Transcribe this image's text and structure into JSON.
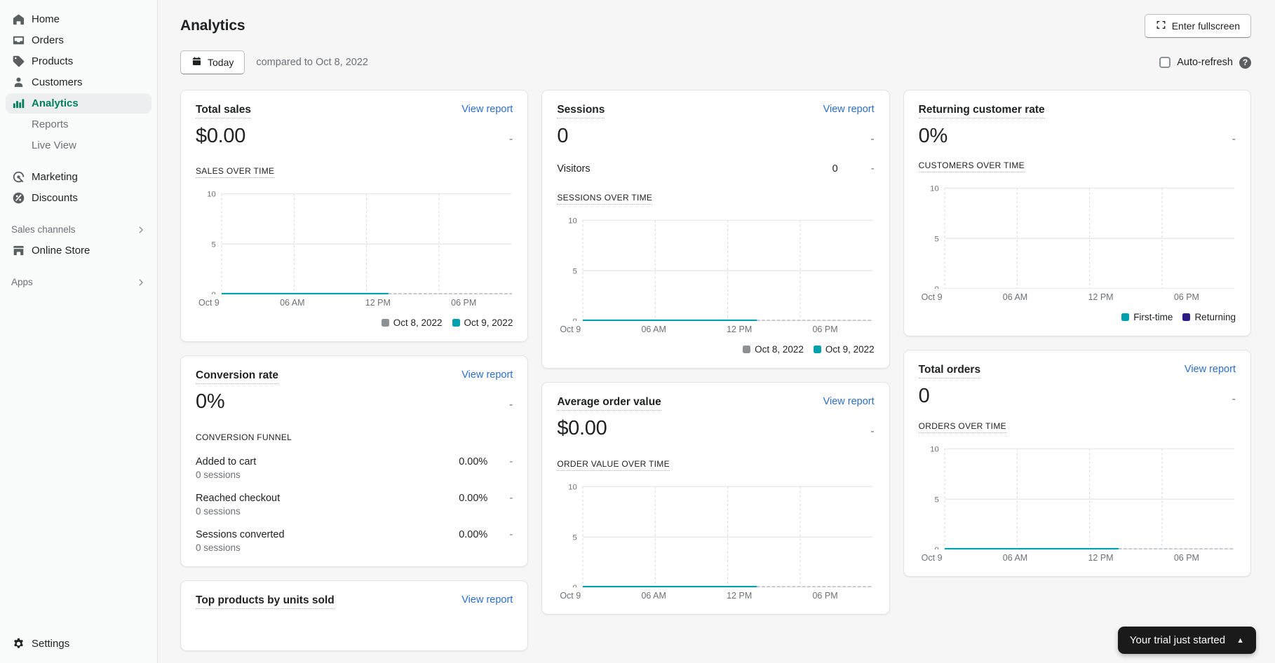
{
  "sidebar": {
    "items": [
      {
        "label": "Home",
        "icon": "home-icon",
        "active": false
      },
      {
        "label": "Orders",
        "icon": "orders-icon",
        "active": false
      },
      {
        "label": "Products",
        "icon": "products-tag-icon",
        "active": false
      },
      {
        "label": "Customers",
        "icon": "customers-person-icon",
        "active": false
      },
      {
        "label": "Analytics",
        "icon": "analytics-bars-icon",
        "active": true
      }
    ],
    "sub_items": [
      {
        "label": "Reports"
      },
      {
        "label": "Live View"
      }
    ],
    "items2": [
      {
        "label": "Marketing",
        "icon": "marketing-icon"
      },
      {
        "label": "Discounts",
        "icon": "discounts-icon"
      }
    ],
    "sales_channels": {
      "label": "Sales channels"
    },
    "online_store": {
      "label": "Online Store",
      "icon": "store-icon"
    },
    "apps": {
      "label": "Apps"
    },
    "settings": {
      "label": "Settings",
      "icon": "gear-icon"
    }
  },
  "header": {
    "title": "Analytics",
    "fullscreen_label": "Enter fullscreen"
  },
  "filters": {
    "date_label": "Today",
    "compared_to": "compared to Oct 8, 2022",
    "auto_refresh_label": "Auto-refresh",
    "help_glyph": "?"
  },
  "colors": {
    "teal": "#00a0ac",
    "grey": "#8c9196",
    "navy": "#2e1a87",
    "link": "#2c6ecb",
    "accent_green": "#007f5f"
  },
  "cards": {
    "total_sales": {
      "title": "Total sales",
      "view_report": "View report",
      "value": "$0.00",
      "delta": "-",
      "chart_caption": "SALES OVER TIME"
    },
    "conversion_rate": {
      "title": "Conversion rate",
      "view_report": "View report",
      "value": "0%",
      "delta": "-",
      "funnel_caption": "CONVERSION FUNNEL",
      "rows": [
        {
          "label": "Added to cart",
          "sub": "0 sessions",
          "pct": "0.00%",
          "delta": "-"
        },
        {
          "label": "Reached checkout",
          "sub": "0 sessions",
          "pct": "0.00%",
          "delta": "-"
        },
        {
          "label": "Sessions converted",
          "sub": "0 sessions",
          "pct": "0.00%",
          "delta": "-"
        }
      ]
    },
    "top_products": {
      "title": "Top products by units sold",
      "view_report": "View report"
    },
    "sessions": {
      "title": "Sessions",
      "view_report": "View report",
      "value": "0",
      "delta": "-",
      "visitors_label": "Visitors",
      "visitors_value": "0",
      "visitors_delta": "-",
      "chart_caption": "SESSIONS OVER TIME"
    },
    "average_order_value": {
      "title": "Average order value",
      "view_report": "View report",
      "value": "$0.00",
      "delta": "-",
      "chart_caption": "ORDER VALUE OVER TIME"
    },
    "returning_customer_rate": {
      "title": "Returning customer rate",
      "value": "0%",
      "delta": "-",
      "chart_caption": "CUSTOMERS OVER TIME"
    },
    "total_orders": {
      "title": "Total orders",
      "view_report": "View report",
      "value": "0",
      "delta": "-",
      "chart_caption": "ORDERS OVER TIME"
    }
  },
  "toast": {
    "message": "Your trial just started",
    "caret": "▲"
  },
  "chart_data": [
    {
      "id": "sales_over_time",
      "type": "line",
      "title": "SALES OVER TIME",
      "xlabel": "",
      "ylabel": "",
      "ylim": [
        0,
        10
      ],
      "yticks": [
        0,
        5,
        10
      ],
      "ytick_labels": [
        "0",
        "5",
        "10"
      ],
      "xtick_labels": [
        "Oct 9",
        "06 AM",
        "12 PM",
        "06 PM"
      ],
      "grid": true,
      "legend": [
        {
          "name": "Oct 8, 2022",
          "color": "#8c9196"
        },
        {
          "name": "Oct 9, 2022",
          "color": "#00a0ac"
        }
      ],
      "series": [
        {
          "name": "Oct 9, 2022",
          "color": "#00a0ac",
          "style": "solid",
          "x_frac_end": 0.575,
          "values": [
            0,
            0,
            0,
            0,
            0,
            0,
            0,
            0,
            0,
            0,
            0,
            0,
            0,
            0
          ]
        },
        {
          "name": "Oct 8, 2022",
          "color": "#c4c8cc",
          "style": "dotted",
          "x_frac_start": 0.575,
          "values": [
            0,
            0,
            0,
            0,
            0,
            0,
            0,
            0,
            0,
            0
          ]
        }
      ]
    },
    {
      "id": "sessions_over_time",
      "type": "line",
      "title": "SESSIONS OVER TIME",
      "ylim": [
        0,
        10
      ],
      "yticks": [
        0,
        5,
        10
      ],
      "ytick_labels": [
        "0",
        "5",
        "10"
      ],
      "xtick_labels": [
        "Oct 9",
        "06 AM",
        "12 PM",
        "06 PM"
      ],
      "grid": true,
      "legend": [
        {
          "name": "Oct 8, 2022",
          "color": "#8c9196"
        },
        {
          "name": "Oct 9, 2022",
          "color": "#00a0ac"
        }
      ],
      "series": [
        {
          "name": "Oct 9, 2022",
          "color": "#00a0ac",
          "style": "solid",
          "x_frac_end": 0.6,
          "values": [
            0,
            0,
            0,
            0,
            0,
            0,
            0,
            0,
            0,
            0
          ]
        },
        {
          "name": "Oct 8, 2022",
          "color": "#c4c8cc",
          "style": "dotted",
          "x_frac_start": 0.6,
          "values": [
            0,
            0,
            0,
            0,
            0,
            0,
            0
          ]
        }
      ]
    },
    {
      "id": "customers_over_time",
      "type": "line",
      "title": "CUSTOMERS OVER TIME",
      "ylim": [
        0,
        10
      ],
      "yticks": [
        0,
        5,
        10
      ],
      "ytick_labels": [
        "0",
        "5",
        "10"
      ],
      "xtick_labels": [
        "Oct 9",
        "06 AM",
        "12 PM",
        "06 PM"
      ],
      "grid": true,
      "legend": [
        {
          "name": "First-time",
          "color": "#00a0ac"
        },
        {
          "name": "Returning",
          "color": "#2e1a87"
        }
      ],
      "series": []
    },
    {
      "id": "order_value_over_time",
      "type": "line",
      "title": "ORDER VALUE OVER TIME",
      "ylim": [
        0,
        10
      ],
      "yticks": [
        0,
        5,
        10
      ],
      "ytick_labels": [
        "0",
        "5",
        "10"
      ],
      "xtick_labels": [
        "Oct 9",
        "06 AM",
        "12 PM",
        "06 PM"
      ],
      "grid": true,
      "legend": [],
      "series": [
        {
          "name": "Oct 9, 2022",
          "color": "#00a0ac",
          "style": "solid",
          "x_frac_end": 0.6,
          "values": [
            0,
            0,
            0,
            0,
            0,
            0,
            0,
            0,
            0,
            0
          ]
        },
        {
          "name": "Oct 8, 2022",
          "color": "#c4c8cc",
          "style": "dotted",
          "x_frac_start": 0.6,
          "values": [
            0,
            0,
            0,
            0,
            0,
            0,
            0
          ]
        }
      ]
    },
    {
      "id": "orders_over_time",
      "type": "line",
      "title": "ORDERS OVER TIME",
      "ylim": [
        0,
        10
      ],
      "yticks": [
        0,
        5,
        10
      ],
      "ytick_labels": [
        "0",
        "5",
        "10"
      ],
      "xtick_labels": [
        "Oct 9",
        "06 AM",
        "12 PM",
        "06 PM"
      ],
      "grid": true,
      "legend": [],
      "series": [
        {
          "name": "Oct 9, 2022",
          "color": "#00a0ac",
          "style": "solid",
          "x_frac_end": 0.6,
          "values": [
            0,
            0,
            0,
            0,
            0,
            0,
            0,
            0,
            0,
            0
          ]
        },
        {
          "name": "Oct 8, 2022",
          "color": "#c4c8cc",
          "style": "dotted",
          "x_frac_start": 0.6,
          "values": [
            0,
            0,
            0,
            0,
            0,
            0,
            0
          ]
        }
      ]
    }
  ]
}
